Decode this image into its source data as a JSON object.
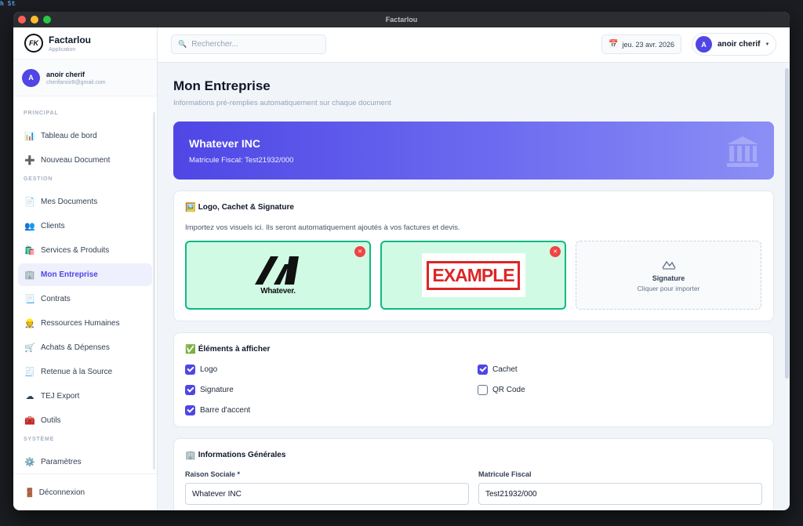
{
  "window": {
    "title": "Factarlou"
  },
  "brand": {
    "name": "Factarlou",
    "subtitle": "Application",
    "logo_text": "FK"
  },
  "user": {
    "initial": "A",
    "name": "anoir cherif",
    "email": "cherifanoir8@gmail.com"
  },
  "nav": {
    "sections": [
      {
        "title": "PRINCIPAL",
        "items": [
          {
            "label": "Tableau de bord",
            "icon": "bar-chart-icon",
            "glyph": "📊"
          },
          {
            "label": "Nouveau Document",
            "icon": "plus-icon",
            "glyph": "➕"
          }
        ]
      },
      {
        "title": "GESTION",
        "items": [
          {
            "label": "Mes Documents",
            "icon": "document-icon",
            "glyph": "📄"
          },
          {
            "label": "Clients",
            "icon": "users-icon",
            "glyph": "👥"
          },
          {
            "label": "Services & Produits",
            "icon": "shopping-bags-icon",
            "glyph": "🛍️"
          },
          {
            "label": "Mon Entreprise",
            "icon": "office-building-icon",
            "glyph": "🏢",
            "active": true
          },
          {
            "label": "Contrats",
            "icon": "scroll-icon",
            "glyph": "📃"
          },
          {
            "label": "Ressources Humaines",
            "icon": "worker-icon",
            "glyph": "👷"
          },
          {
            "label": "Achats & Dépenses",
            "icon": "shopping-cart-icon",
            "glyph": "🛒"
          },
          {
            "label": "Retenue à la Source",
            "icon": "receipt-icon",
            "glyph": "🧾"
          },
          {
            "label": "TEJ Export",
            "icon": "cloud-icon",
            "glyph": "☁"
          },
          {
            "label": "Outils",
            "icon": "toolbox-icon",
            "glyph": "🧰"
          }
        ]
      },
      {
        "title": "SYSTÈME",
        "items": [
          {
            "label": "Paramètres",
            "icon": "gear-icon",
            "glyph": "⚙️"
          }
        ]
      }
    ],
    "logout_label": "Déconnexion"
  },
  "topbar": {
    "search_placeholder": "Rechercher...",
    "date": "jeu. 23 avr. 2026",
    "user_name": "anoir cherif"
  },
  "page": {
    "title": "Mon Entreprise",
    "subtitle": "Informations pré-remplies automatiquement sur chaque document"
  },
  "hero": {
    "company": "Whatever INC",
    "matricule": "Matricule Fiscal: Test21932/000"
  },
  "visuals": {
    "title": "Logo, Cachet & Signature",
    "description": "Importez vos visuels ici. Ils seront automatiquement ajoutés à vos factures et devis.",
    "logo_text": "Whatever.",
    "stamp_text": "EXAMPLE",
    "signature_label": "Signature",
    "signature_hint": "Cliquer pour importer"
  },
  "display": {
    "title": "Éléments à afficher",
    "options": [
      {
        "label": "Logo",
        "checked": true
      },
      {
        "label": "Cachet",
        "checked": true
      },
      {
        "label": "Signature",
        "checked": true
      },
      {
        "label": "QR Code",
        "checked": false
      },
      {
        "label": "Barre d'accent",
        "checked": true
      }
    ]
  },
  "general": {
    "title": "Informations Générales",
    "raison_label": "Raison Sociale *",
    "raison_value": "Whatever INC",
    "matricule_label": "Matricule Fiscal",
    "matricule_value": "Test21932/000"
  },
  "colors": {
    "accent": "#4f46e5",
    "success": "#10b981",
    "danger": "#ef4444"
  }
}
